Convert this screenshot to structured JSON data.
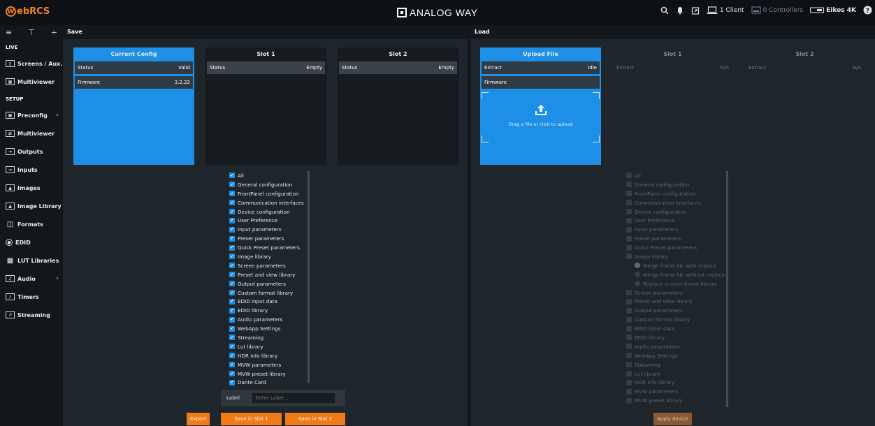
{
  "header": {
    "app_name": "ebRCS",
    "brand": "ANALOG WAY",
    "clients": "1 Client",
    "controllers": "0 Controllers",
    "device": "Eikos 4K"
  },
  "sidebar": {
    "sections": [
      {
        "title": "LIVE",
        "items": [
          {
            "label": "Screens / Aux.",
            "icon": "screens-icon"
          },
          {
            "label": "Multiviewer",
            "icon": "multiviewer-icon"
          }
        ]
      },
      {
        "title": "SETUP",
        "items": [
          {
            "label": "Preconfig",
            "icon": "preconfig-icon",
            "chevron": true
          },
          {
            "label": "Multiviewer",
            "icon": "multiviewer-setup-icon"
          },
          {
            "label": "Outputs",
            "icon": "outputs-icon"
          },
          {
            "label": "Inputs",
            "icon": "inputs-icon"
          },
          {
            "label": "Images",
            "icon": "images-icon"
          },
          {
            "label": "Image Library",
            "icon": "image-library-icon"
          },
          {
            "label": "Formats",
            "icon": "formats-icon"
          },
          {
            "label": "EDID",
            "icon": "edid-icon"
          },
          {
            "label": "LUT Libraries",
            "icon": "lut-libraries-icon"
          },
          {
            "label": "Audio",
            "icon": "audio-icon",
            "chevron": true
          },
          {
            "label": "Timers",
            "icon": "timers-icon"
          },
          {
            "label": "Streaming",
            "icon": "streaming-icon"
          }
        ]
      }
    ]
  },
  "save": {
    "title": "Save",
    "current": {
      "title": "Current Config",
      "status_label": "Status",
      "status_value": "Valid",
      "firmware_label": "Firmware",
      "firmware_value": "3.2.22"
    },
    "slot1": {
      "title": "Slot 1",
      "status_label": "Status",
      "status_value": "Empty"
    },
    "slot2": {
      "title": "Slot 2",
      "status_label": "Status",
      "status_value": "Empty"
    },
    "checklist": [
      "All",
      "General configuration",
      "FrontPanel configuration",
      "Communication interfaces",
      "Device configuration",
      "User Preference",
      "Input parameters",
      "Preset parameters",
      "Quick Preset parameters",
      "Image library",
      "Screen parameters",
      "Preset and view library",
      "Output parameters",
      "Custom format library",
      "EDID input data",
      "EDID library",
      "Audio parameters",
      "WebApp Settings",
      "Streaming",
      "Lut library",
      "HDR info library",
      "MVW parameters",
      "MVW preset library",
      "Dante Card"
    ],
    "label_text": "Label",
    "label_placeholder": "Enter Label...",
    "export_btn": "Export",
    "save_slot1_btn": "Save in Slot 1",
    "save_slot2_btn": "Save in Slot 2"
  },
  "load": {
    "title": "Load",
    "upload": {
      "title": "Upload File",
      "extract_label": "Extract",
      "extract_value": "Idle",
      "firmware_label": "Firmware",
      "drop_text": "Drag a file or click to upload"
    },
    "slot1": {
      "title": "Slot 1",
      "extract_label": "Extract",
      "extract_value": "N/A"
    },
    "slot2": {
      "title": "Slot 2",
      "extract_label": "Extract",
      "extract_value": "N/A"
    },
    "checklist_top": [
      "All",
      "General configuration",
      "FrontPanel configuration",
      "Communication interfaces",
      "Device configuration",
      "User Preference",
      "Input parameters",
      "Preset parameters",
      "Quick Preset parameters",
      "Image library"
    ],
    "sub_options": [
      "Merge frame lib. with replace",
      "Merge frame lib. without replace",
      "Replace current frame library"
    ],
    "checklist_bottom": [
      "Screen parameters",
      "Preset and view library",
      "Output parameters",
      "Custom format library",
      "EDID input data",
      "EDID library",
      "Audio parameters",
      "WebApp Settings",
      "Streaming",
      "Lut library",
      "HDR info library",
      "MVW parameters",
      "MVW preset library"
    ],
    "apply_btn": "Apply device"
  }
}
